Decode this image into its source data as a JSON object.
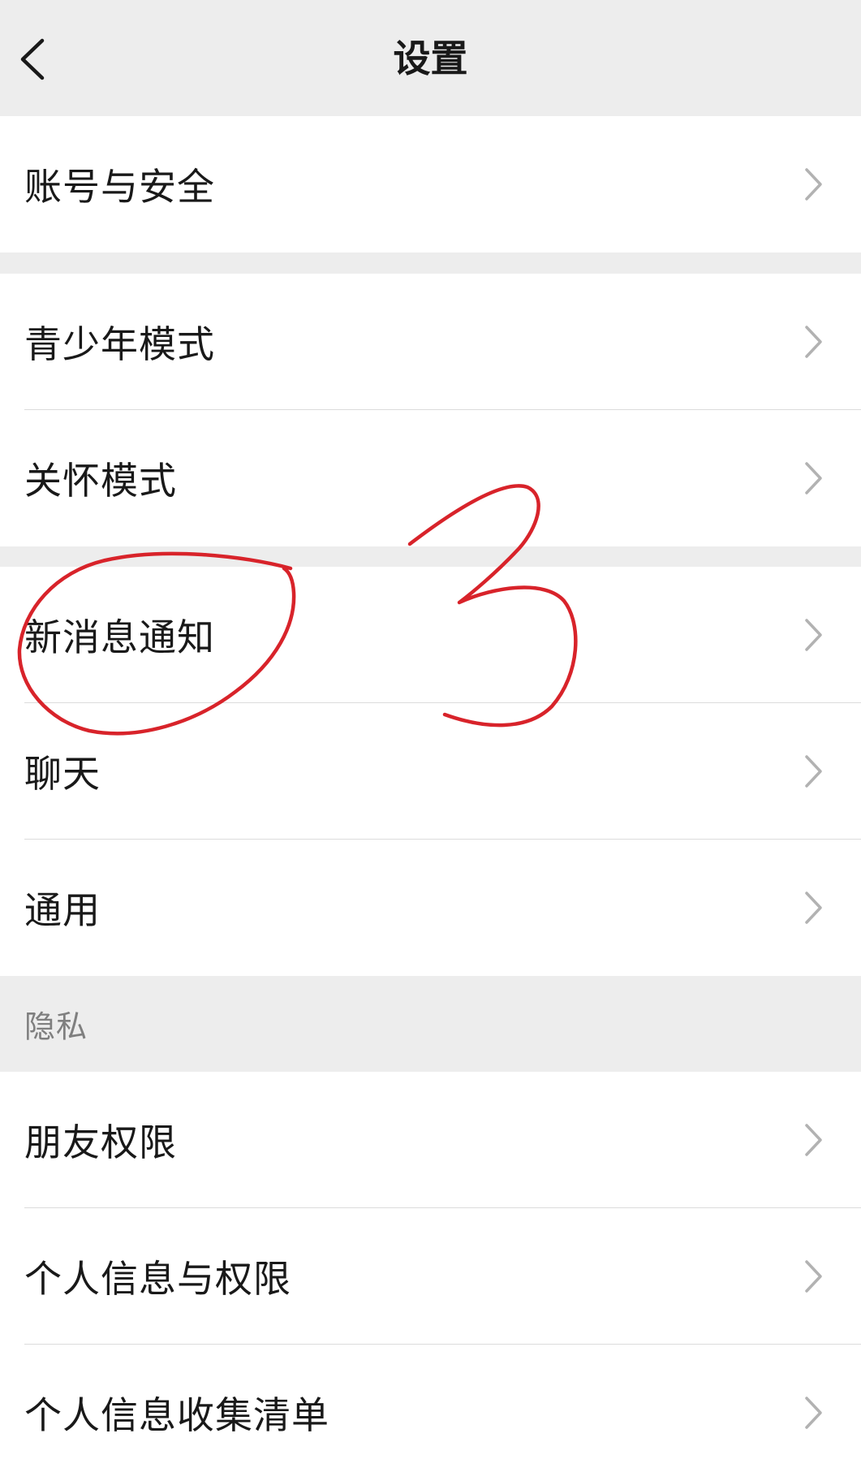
{
  "header": {
    "title": "设置",
    "back_icon": "chevron-left-icon"
  },
  "groups": [
    {
      "items": [
        {
          "label": "账号与安全",
          "icon": "chevron-right-icon"
        }
      ]
    },
    {
      "items": [
        {
          "label": "青少年模式",
          "icon": "chevron-right-icon"
        },
        {
          "label": "关怀模式",
          "icon": "chevron-right-icon"
        }
      ]
    },
    {
      "items": [
        {
          "label": "新消息通知",
          "icon": "chevron-right-icon"
        },
        {
          "label": "聊天",
          "icon": "chevron-right-icon"
        },
        {
          "label": "通用",
          "icon": "chevron-right-icon"
        }
      ]
    }
  ],
  "privacy": {
    "header": "隐私",
    "items": [
      {
        "label": "朋友权限",
        "icon": "chevron-right-icon"
      },
      {
        "label": "个人信息与权限",
        "icon": "chevron-right-icon"
      },
      {
        "label": "个人信息收集清单",
        "icon": "chevron-right-icon"
      }
    ]
  },
  "annotation": {
    "number": "3",
    "color": "#d8232a",
    "highlighted_item": "新消息通知"
  },
  "colors": {
    "background": "#ededed",
    "card": "#ffffff",
    "text": "#191919",
    "section_text": "#7f7f7f",
    "chevron": "#b2b2b2"
  }
}
